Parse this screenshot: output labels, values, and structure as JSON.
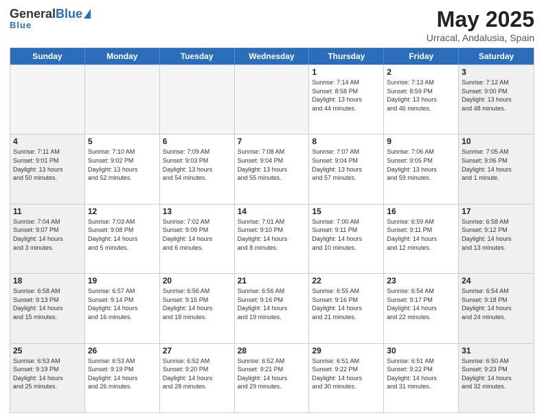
{
  "header": {
    "logo_general": "General",
    "logo_blue": "Blue",
    "title": "May 2025",
    "subtitle": "Urracal, Andalusia, Spain"
  },
  "calendar": {
    "days": [
      "Sunday",
      "Monday",
      "Tuesday",
      "Wednesday",
      "Thursday",
      "Friday",
      "Saturday"
    ],
    "rows": [
      [
        {
          "day": "",
          "lines": []
        },
        {
          "day": "",
          "lines": []
        },
        {
          "day": "",
          "lines": []
        },
        {
          "day": "",
          "lines": []
        },
        {
          "day": "1",
          "lines": [
            "Sunrise: 7:14 AM",
            "Sunset: 8:58 PM",
            "Daylight: 13 hours",
            "and 44 minutes."
          ]
        },
        {
          "day": "2",
          "lines": [
            "Sunrise: 7:13 AM",
            "Sunset: 8:59 PM",
            "Daylight: 13 hours",
            "and 46 minutes."
          ]
        },
        {
          "day": "3",
          "lines": [
            "Sunrise: 7:12 AM",
            "Sunset: 9:00 PM",
            "Daylight: 13 hours",
            "and 48 minutes."
          ]
        }
      ],
      [
        {
          "day": "4",
          "lines": [
            "Sunrise: 7:11 AM",
            "Sunset: 9:01 PM",
            "Daylight: 13 hours",
            "and 50 minutes."
          ]
        },
        {
          "day": "5",
          "lines": [
            "Sunrise: 7:10 AM",
            "Sunset: 9:02 PM",
            "Daylight: 13 hours",
            "and 52 minutes."
          ]
        },
        {
          "day": "6",
          "lines": [
            "Sunrise: 7:09 AM",
            "Sunset: 9:03 PM",
            "Daylight: 13 hours",
            "and 54 minutes."
          ]
        },
        {
          "day": "7",
          "lines": [
            "Sunrise: 7:08 AM",
            "Sunset: 9:04 PM",
            "Daylight: 13 hours",
            "and 55 minutes."
          ]
        },
        {
          "day": "8",
          "lines": [
            "Sunrise: 7:07 AM",
            "Sunset: 9:04 PM",
            "Daylight: 13 hours",
            "and 57 minutes."
          ]
        },
        {
          "day": "9",
          "lines": [
            "Sunrise: 7:06 AM",
            "Sunset: 9:05 PM",
            "Daylight: 13 hours",
            "and 59 minutes."
          ]
        },
        {
          "day": "10",
          "lines": [
            "Sunrise: 7:05 AM",
            "Sunset: 9:06 PM",
            "Daylight: 14 hours",
            "and 1 minute."
          ]
        }
      ],
      [
        {
          "day": "11",
          "lines": [
            "Sunrise: 7:04 AM",
            "Sunset: 9:07 PM",
            "Daylight: 14 hours",
            "and 3 minutes."
          ]
        },
        {
          "day": "12",
          "lines": [
            "Sunrise: 7:03 AM",
            "Sunset: 9:08 PM",
            "Daylight: 14 hours",
            "and 5 minutes."
          ]
        },
        {
          "day": "13",
          "lines": [
            "Sunrise: 7:02 AM",
            "Sunset: 9:09 PM",
            "Daylight: 14 hours",
            "and 6 minutes."
          ]
        },
        {
          "day": "14",
          "lines": [
            "Sunrise: 7:01 AM",
            "Sunset: 9:10 PM",
            "Daylight: 14 hours",
            "and 8 minutes."
          ]
        },
        {
          "day": "15",
          "lines": [
            "Sunrise: 7:00 AM",
            "Sunset: 9:11 PM",
            "Daylight: 14 hours",
            "and 10 minutes."
          ]
        },
        {
          "day": "16",
          "lines": [
            "Sunrise: 6:59 AM",
            "Sunset: 9:11 PM",
            "Daylight: 14 hours",
            "and 12 minutes."
          ]
        },
        {
          "day": "17",
          "lines": [
            "Sunrise: 6:58 AM",
            "Sunset: 9:12 PM",
            "Daylight: 14 hours",
            "and 13 minutes."
          ]
        }
      ],
      [
        {
          "day": "18",
          "lines": [
            "Sunrise: 6:58 AM",
            "Sunset: 9:13 PM",
            "Daylight: 14 hours",
            "and 15 minutes."
          ]
        },
        {
          "day": "19",
          "lines": [
            "Sunrise: 6:57 AM",
            "Sunset: 9:14 PM",
            "Daylight: 14 hours",
            "and 16 minutes."
          ]
        },
        {
          "day": "20",
          "lines": [
            "Sunrise: 6:56 AM",
            "Sunset: 9:15 PM",
            "Daylight: 14 hours",
            "and 18 minutes."
          ]
        },
        {
          "day": "21",
          "lines": [
            "Sunrise: 6:56 AM",
            "Sunset: 9:16 PM",
            "Daylight: 14 hours",
            "and 19 minutes."
          ]
        },
        {
          "day": "22",
          "lines": [
            "Sunrise: 6:55 AM",
            "Sunset: 9:16 PM",
            "Daylight: 14 hours",
            "and 21 minutes."
          ]
        },
        {
          "day": "23",
          "lines": [
            "Sunrise: 6:54 AM",
            "Sunset: 9:17 PM",
            "Daylight: 14 hours",
            "and 22 minutes."
          ]
        },
        {
          "day": "24",
          "lines": [
            "Sunrise: 6:54 AM",
            "Sunset: 9:18 PM",
            "Daylight: 14 hours",
            "and 24 minutes."
          ]
        }
      ],
      [
        {
          "day": "25",
          "lines": [
            "Sunrise: 6:53 AM",
            "Sunset: 9:19 PM",
            "Daylight: 14 hours",
            "and 25 minutes."
          ]
        },
        {
          "day": "26",
          "lines": [
            "Sunrise: 6:53 AM",
            "Sunset: 9:19 PM",
            "Daylight: 14 hours",
            "and 26 minutes."
          ]
        },
        {
          "day": "27",
          "lines": [
            "Sunrise: 6:52 AM",
            "Sunset: 9:20 PM",
            "Daylight: 14 hours",
            "and 28 minutes."
          ]
        },
        {
          "day": "28",
          "lines": [
            "Sunrise: 6:52 AM",
            "Sunset: 9:21 PM",
            "Daylight: 14 hours",
            "and 29 minutes."
          ]
        },
        {
          "day": "29",
          "lines": [
            "Sunrise: 6:51 AM",
            "Sunset: 9:22 PM",
            "Daylight: 14 hours",
            "and 30 minutes."
          ]
        },
        {
          "day": "30",
          "lines": [
            "Sunrise: 6:51 AM",
            "Sunset: 9:22 PM",
            "Daylight: 14 hours",
            "and 31 minutes."
          ]
        },
        {
          "day": "31",
          "lines": [
            "Sunrise: 6:50 AM",
            "Sunset: 9:23 PM",
            "Daylight: 14 hours",
            "and 32 minutes."
          ]
        }
      ]
    ]
  }
}
